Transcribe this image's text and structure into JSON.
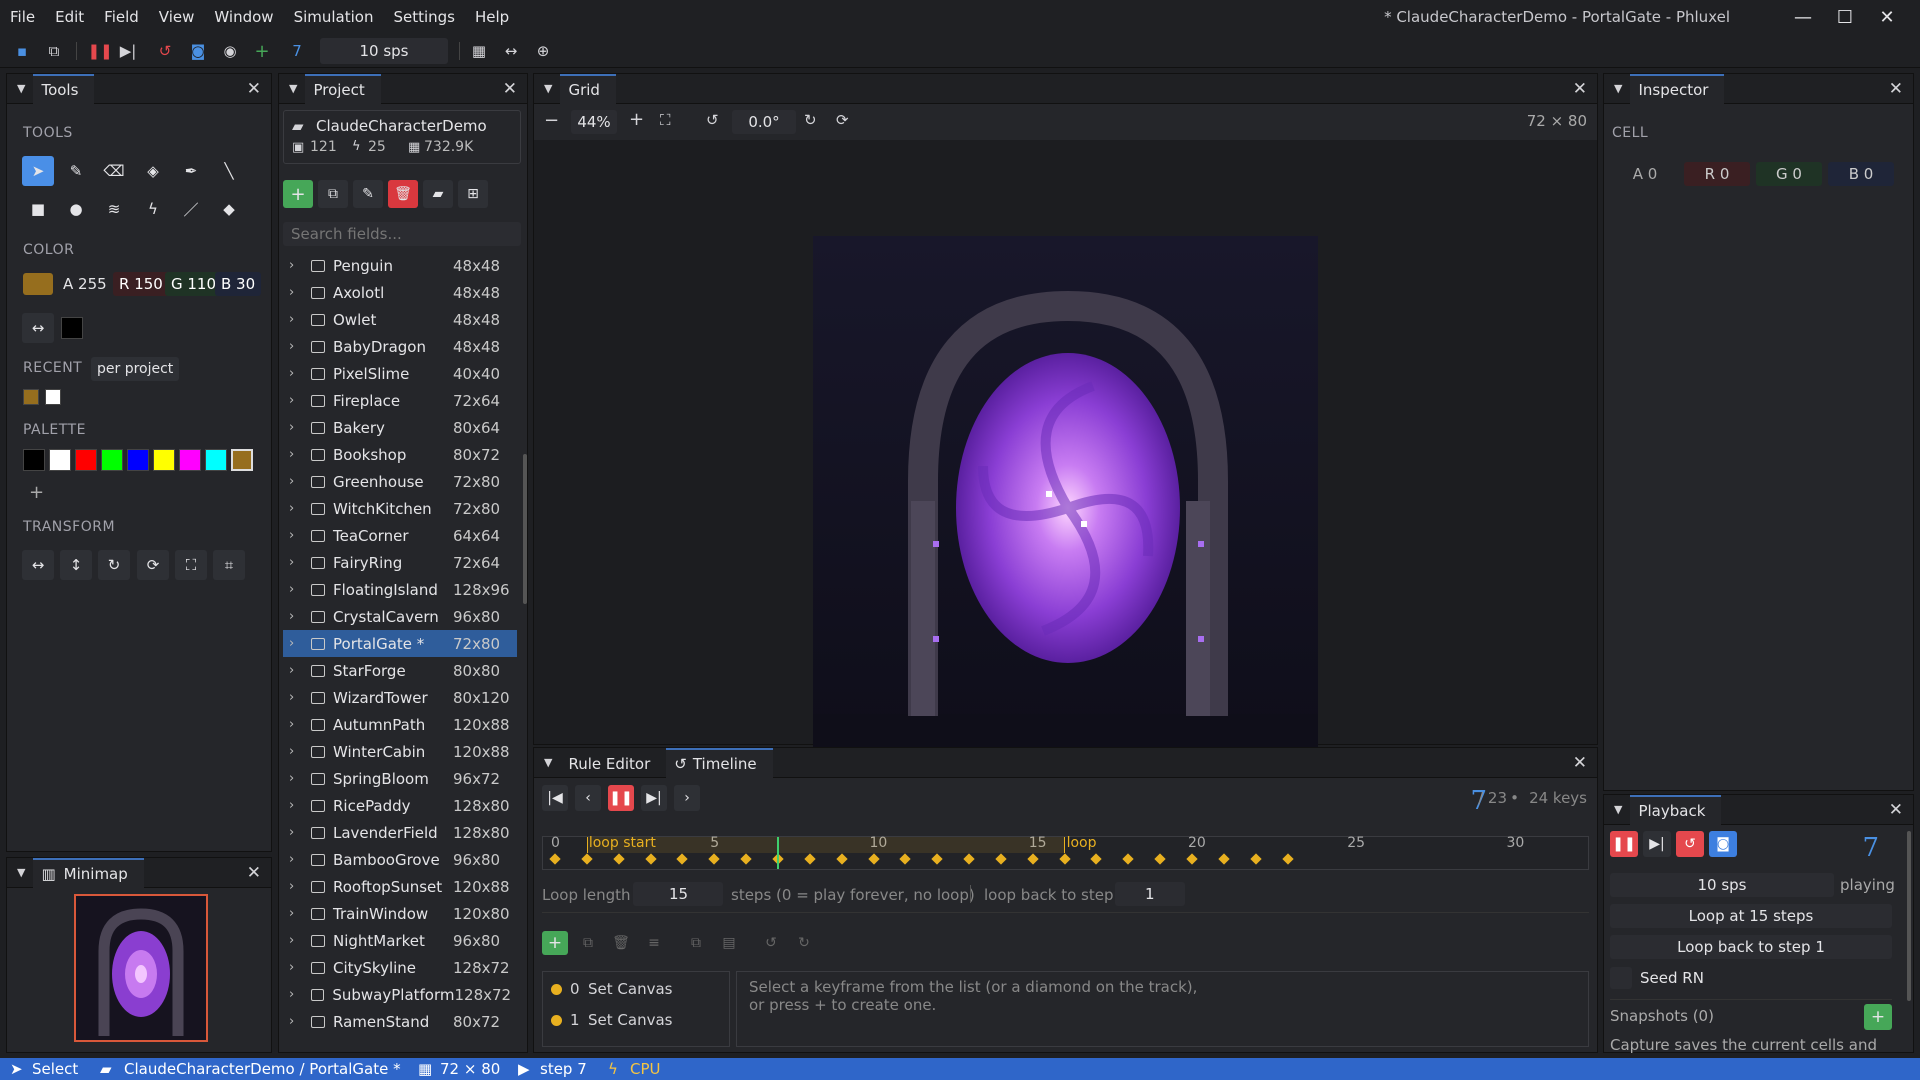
{
  "menu": [
    "File",
    "Edit",
    "Field",
    "View",
    "Window",
    "Simulation",
    "Settings",
    "Help"
  ],
  "window_title": "* ClaudeCharacterDemo - PortalGate - Phluxel",
  "toolbar": {
    "step": "7",
    "sps": "10 sps"
  },
  "tools_panel": {
    "title": "Tools",
    "tools_label": "TOOLS",
    "color_label": "COLOR",
    "color": {
      "a": "A 255",
      "r": "R 150",
      "g": "G 110",
      "b": "B 30",
      "swatch": "#966e1e"
    },
    "recent_label": "RECENT",
    "recent_scope": "per project",
    "recent_colors": [
      "#966e1e",
      "#ffffff"
    ],
    "palette_label": "PALETTE",
    "palette": [
      "#000000",
      "#ffffff",
      "#ff0000",
      "#00ff00",
      "#0000ff",
      "#ffff00",
      "#ff00ff",
      "#00ffff",
      "#966e1e"
    ],
    "transform_label": "TRANSFORM"
  },
  "minimap": {
    "title": "Minimap"
  },
  "project": {
    "title": "Project",
    "name": "ClaudeCharacterDemo",
    "stats": {
      "fields": "121",
      "rules": "25",
      "size": "732.9K"
    },
    "search_placeholder": "Search fields...",
    "fields": [
      {
        "name": "Penguin",
        "size": "48x48"
      },
      {
        "name": "Axolotl",
        "size": "48x48"
      },
      {
        "name": "Owlet",
        "size": "48x48"
      },
      {
        "name": "BabyDragon",
        "size": "48x48"
      },
      {
        "name": "PixelSlime",
        "size": "40x40"
      },
      {
        "name": "Fireplace",
        "size": "72x64"
      },
      {
        "name": "Bakery",
        "size": "80x64"
      },
      {
        "name": "Bookshop",
        "size": "80x72"
      },
      {
        "name": "Greenhouse",
        "size": "72x80"
      },
      {
        "name": "WitchKitchen",
        "size": "72x80"
      },
      {
        "name": "TeaCorner",
        "size": "64x64"
      },
      {
        "name": "FairyRing",
        "size": "72x64"
      },
      {
        "name": "FloatingIsland",
        "size": "128x96"
      },
      {
        "name": "CrystalCavern",
        "size": "96x80"
      },
      {
        "name": "PortalGate  *",
        "size": "72x80"
      },
      {
        "name": "StarForge",
        "size": "80x80"
      },
      {
        "name": "WizardTower",
        "size": "80x120"
      },
      {
        "name": "AutumnPath",
        "size": "120x88"
      },
      {
        "name": "WinterCabin",
        "size": "120x88"
      },
      {
        "name": "SpringBloom",
        "size": "96x72"
      },
      {
        "name": "RicePaddy",
        "size": "128x80"
      },
      {
        "name": "LavenderField",
        "size": "128x80"
      },
      {
        "name": "BambooGrove",
        "size": "96x80"
      },
      {
        "name": "RooftopSunset",
        "size": "120x88"
      },
      {
        "name": "TrainWindow",
        "size": "120x80"
      },
      {
        "name": "NightMarket",
        "size": "96x80"
      },
      {
        "name": "CitySkyline",
        "size": "128x72"
      },
      {
        "name": "SubwayPlatform",
        "size": "128x72"
      },
      {
        "name": "RamenStand",
        "size": "80x72"
      }
    ],
    "selected_index": 14
  },
  "grid": {
    "title": "Grid",
    "zoom": "44%",
    "rotation": "0.0°",
    "dims": "72 × 80"
  },
  "timeline": {
    "tab_rule_editor": "Rule Editor",
    "tab_timeline": "Timeline",
    "step": "7",
    "total": "/ 23",
    "keys": "24 keys",
    "ruler_ticks": [
      "0",
      "5",
      "10",
      "15",
      "20",
      "25",
      "30"
    ],
    "loop_start_label": "loop start",
    "loop_label": "loop",
    "keyframe_count": 24,
    "current_step": 7,
    "loop_length_label": "Loop length",
    "loop_length": "15",
    "steps_hint": "steps  (0 = play forever, no loop)",
    "loop_back_label": "loop back to step",
    "loop_back": "1",
    "keyframes": [
      {
        "index": "0",
        "name": "Set Canvas"
      },
      {
        "index": "1",
        "name": "Set Canvas"
      }
    ],
    "hint_line1": "Select a keyframe from the list (or a diamond on the track),",
    "hint_line2": "or press + to create one."
  },
  "inspector": {
    "title": "Inspector",
    "cell_label": "CELL",
    "a": "A 0",
    "r": "R 0",
    "g": "G 0",
    "b": "B 0"
  },
  "playback": {
    "title": "Playback",
    "step": "7",
    "sps": "10 sps",
    "state": "playing",
    "loop_at": "Loop at 15 steps",
    "loop_back": "Loop back to step 1",
    "seed": "Seed RN",
    "snapshots": "Snapshots (0)",
    "capture_hint": "Capture saves the current cells and"
  },
  "status": {
    "tool": "Select",
    "path": "ClaudeCharacterDemo  /  PortalGate *",
    "dims": "72 × 80",
    "step": "step 7",
    "backend": "CPU"
  }
}
